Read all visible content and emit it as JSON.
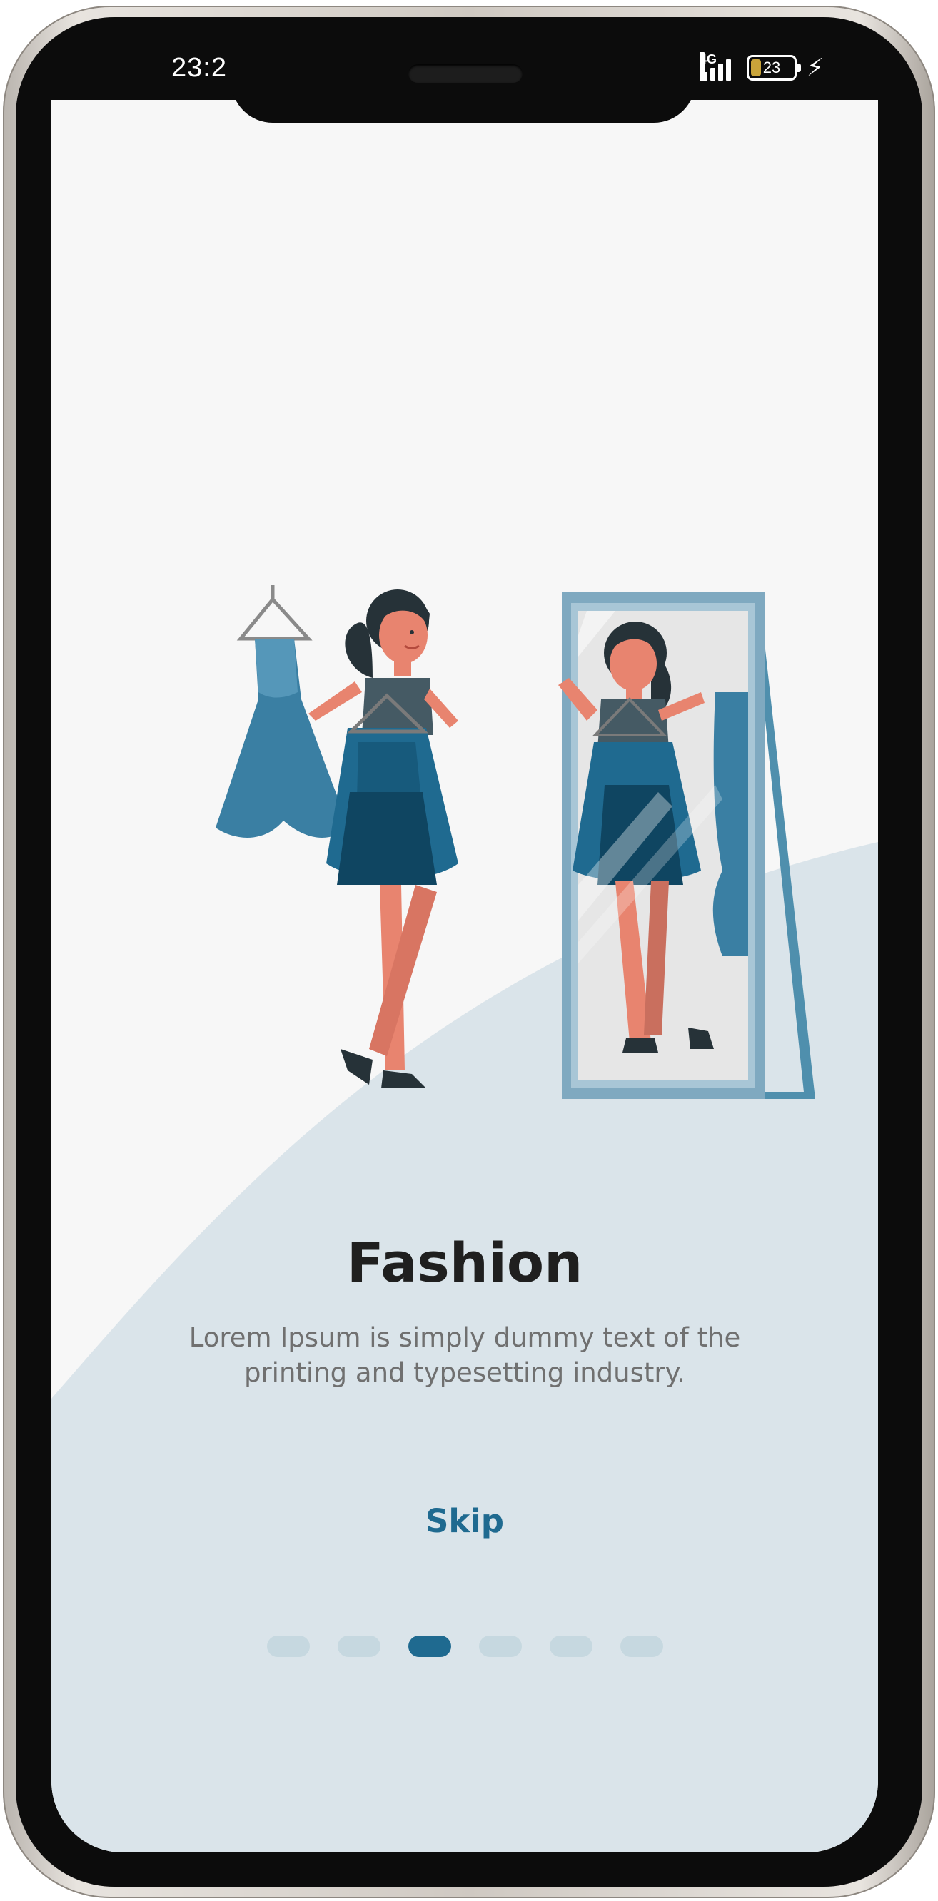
{
  "status_bar": {
    "time": "23:2",
    "network": "4G",
    "battery_level": "23",
    "charging_icon": "bolt-icon"
  },
  "onboarding": {
    "title": "Fashion",
    "description": "Lorem Ipsum is simply dummy text of the printing and typesetting industry.",
    "skip_label": "Skip",
    "pagination": {
      "total": 6,
      "active_index": 2
    }
  },
  "colors": {
    "accent": "#1f6a90",
    "background": "#f7f7f7",
    "wave": "#dae4ea",
    "dot_inactive": "#c6d8e0"
  }
}
